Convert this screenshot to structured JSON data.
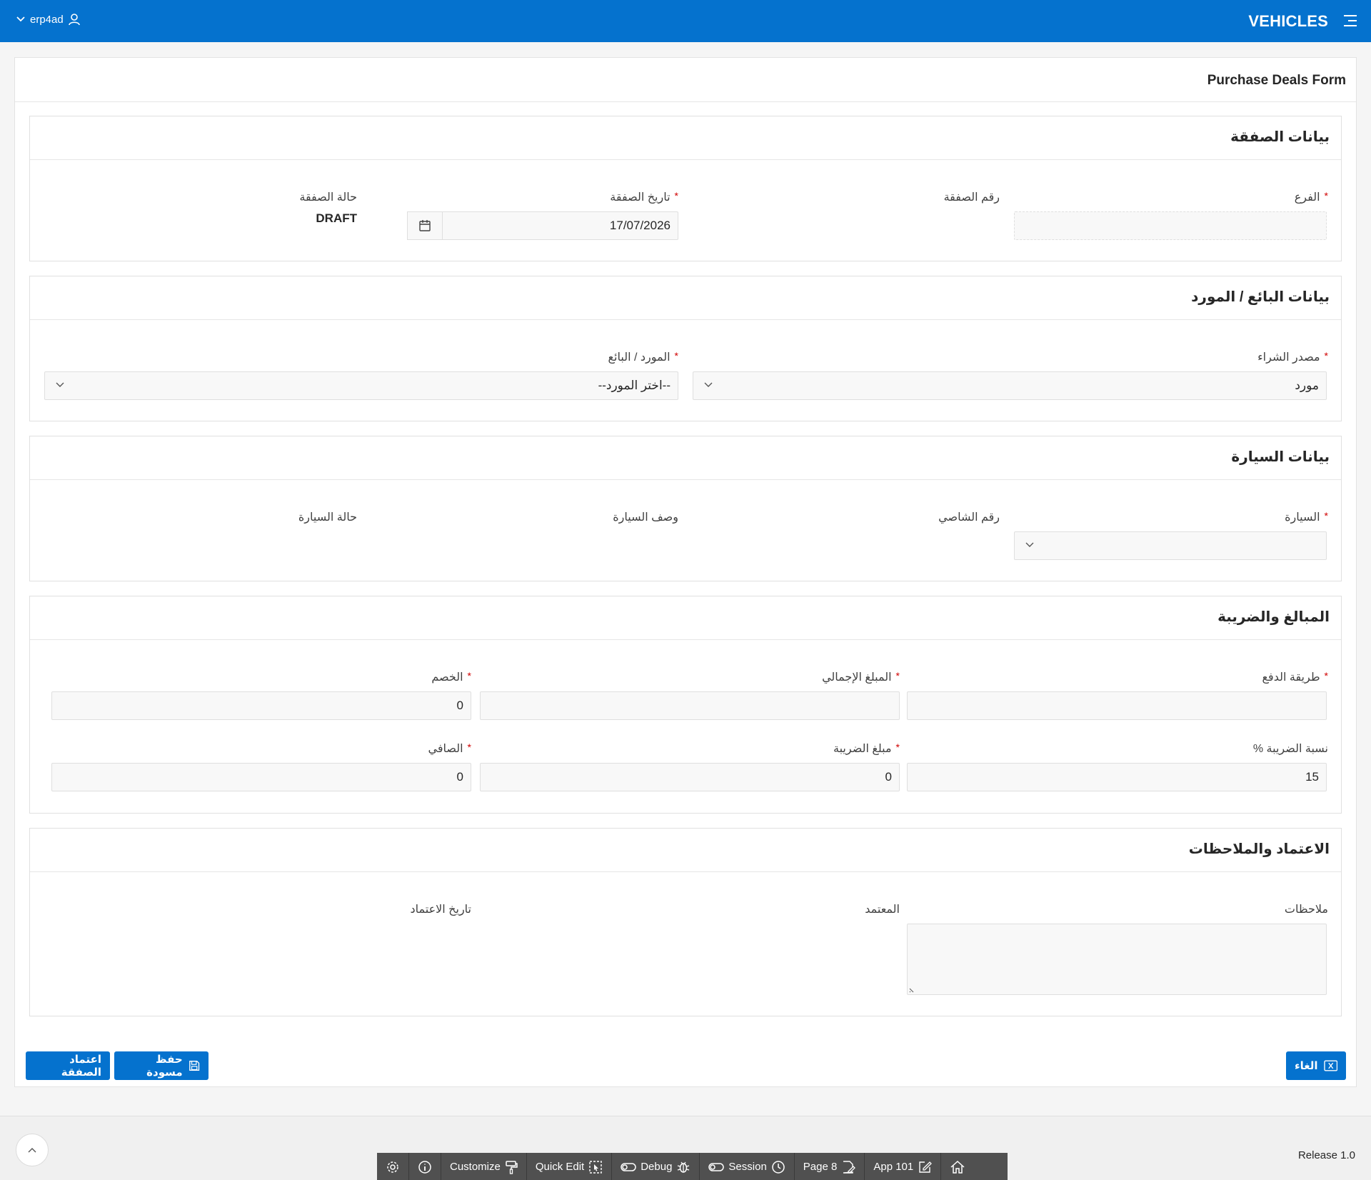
{
  "header": {
    "user": "erp4ad",
    "brand": "VEHICLES"
  },
  "page": {
    "title": "Purchase Deals Form"
  },
  "deal": {
    "title": "بيانات الصفقة",
    "branch_label": "الفرع",
    "number_label": "رقم الصفقة",
    "date_label": "تاريخ الصفقة",
    "date_value": "17/07/2026",
    "status_label": "حالة الصفقة",
    "status_value": "DRAFT"
  },
  "seller": {
    "title": "بيانات البائع / المورد",
    "source_label": "مصدر الشراء",
    "source_value": "مورد",
    "supplier_label": "المورد / البائع",
    "supplier_value": "--اختر المورد--"
  },
  "car": {
    "title": "بيانات السيارة",
    "car_label": "السيارة",
    "chassis_label": "رقم الشاصي",
    "desc_label": "وصف السيارة",
    "status_label": "حالة السيارة"
  },
  "amounts": {
    "title": "المبالغ والضريبة",
    "payment_label": "طريقة الدفع",
    "total_label": "المبلغ الإجمالي",
    "discount_label": "الخصم",
    "discount_value": "0",
    "taxrate_label": "نسبة الضريبة %",
    "taxrate_value": "15",
    "taxamount_label": "مبلغ الضريبة",
    "taxamount_value": "0",
    "net_label": "الصافي",
    "net_value": "0"
  },
  "approval": {
    "title": "الاعتماد والملاحظات",
    "notes_label": "ملاحظات",
    "approver_label": "المعتمد",
    "date_label": "تاريخ الاعتماد"
  },
  "buttons": {
    "approve": "اعتماد الصفقة",
    "save_draft": "حفظ مسودة",
    "cancel": "الغاء"
  },
  "footer": {
    "release": "Release 1.0",
    "devbar": {
      "customize": "Customize",
      "quick_edit": "Quick Edit",
      "debug": "Debug",
      "session": "Session",
      "page": "Page 8",
      "app": "App 101"
    }
  }
}
